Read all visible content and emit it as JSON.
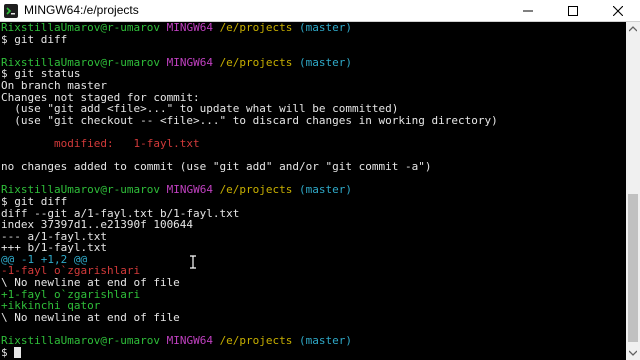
{
  "window": {
    "title": "MINGW64:/e/projects",
    "minimize_icon": "minimize-icon",
    "maximize_icon": "maximize-icon",
    "close_icon": "close-icon"
  },
  "colors": {
    "background": "#000000",
    "text": "#e6e6e6",
    "user": "#2fbf3a",
    "system": "#c040c0",
    "path": "#c8b000",
    "branch": "#2fa9c8",
    "removed": "#d23a3a",
    "added": "#2fbf3a"
  },
  "prompt": {
    "user": "RixstillaUmarov@r-umarov",
    "system": "MINGW64",
    "path": "/e/projects",
    "branch": "(master)"
  },
  "terminal": {
    "cmd1": "$ git diff",
    "cmd2": "$ git status",
    "status_lines": [
      "On branch master",
      "Changes not staged for commit:",
      "  (use \"git add <file>...\" to update what will be committed)",
      "  (use \"git checkout -- <file>...\" to discard changes in working directory)"
    ],
    "modified_label": "        modified:   1-fayl.txt",
    "no_changes": "no changes added to commit (use \"git add\" and/or \"git commit -a\")",
    "cmd3": "$ git diff",
    "diff_header": [
      "diff --git a/1-fayl.txt b/1-fayl.txt",
      "index 37397d1..e21390f 100644",
      "--- a/1-fayl.txt",
      "+++ b/1-fayl.txt"
    ],
    "hunk": "@@ -1 +1,2 @@",
    "removed_line": "-1-fayl o`zgarishlari",
    "no_newline_1": "\\ No newline at end of file",
    "added_line_1": "+1-fayl o`zgarishlari",
    "added_line_2": "+ikkinchi qator",
    "no_newline_2": "\\ No newline at end of file",
    "final_prompt": "$ "
  }
}
